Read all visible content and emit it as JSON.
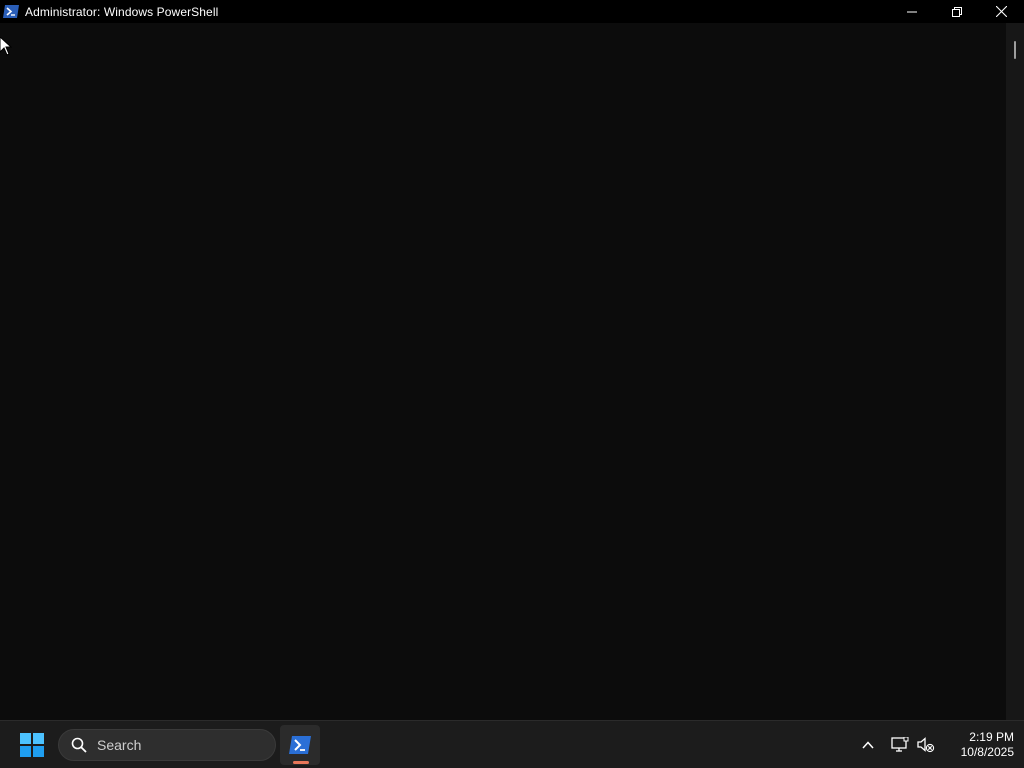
{
  "window": {
    "title": "Administrator: Windows PowerShell",
    "app_icon": "powershell-icon"
  },
  "caption": {
    "minimize_icon": "minimize-icon",
    "restore_icon": "restore-icon",
    "close_icon": "close-icon"
  },
  "console": {
    "background": "#0c0c0c",
    "text": ""
  },
  "taskbar": {
    "start_icon": "windows-start-icon",
    "search_placeholder": "Search",
    "pinned_apps": [
      {
        "name": "Windows PowerShell",
        "icon": "powershell-icon",
        "active": true
      }
    ],
    "accent": "#e8775a"
  },
  "tray": {
    "icons": [
      "chevron-up-icon",
      "network-icon",
      "volume-muted-icon"
    ]
  },
  "clock": {
    "time": "2:19 PM",
    "date": "10/8/2025"
  }
}
